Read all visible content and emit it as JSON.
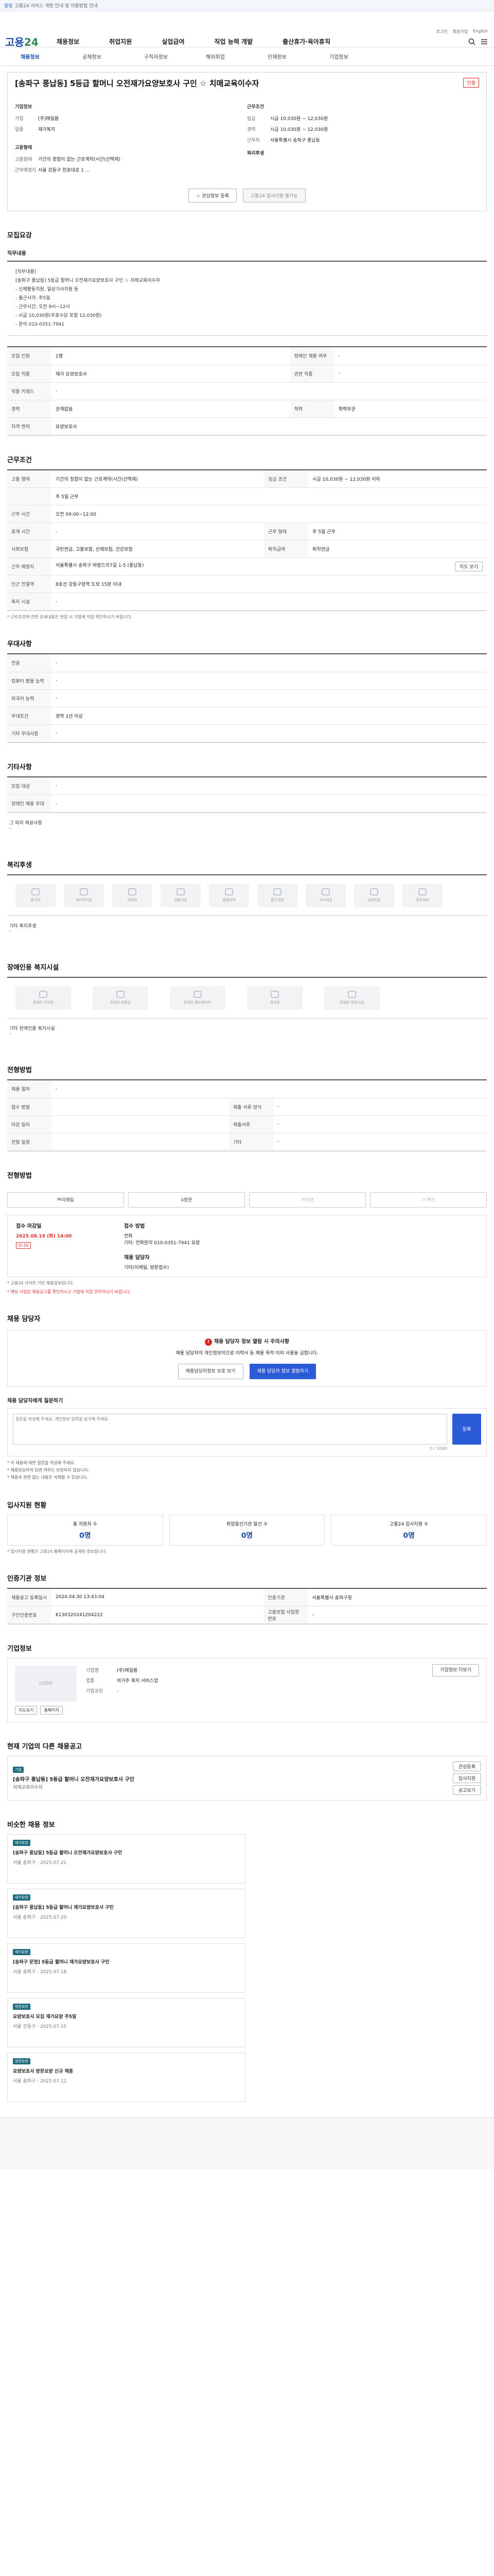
{
  "topbar": {
    "notice": "알림",
    "text": "고용24 서비스 개편 안내 및 이용방법 안내"
  },
  "header": {
    "logo_main": "고용",
    "logo_sub": "24",
    "gnb": [
      "채용정보",
      "취업지원",
      "실업급여",
      "직업 능력 개발",
      "출산휴가·육아휴직"
    ],
    "util": [
      "로그인",
      "회원가입",
      "English"
    ]
  },
  "subnav": {
    "items": [
      "채용정보",
      "공채정보",
      "구직자정보",
      "해외취업",
      "인재정보",
      "기업정보"
    ],
    "active": "채용정보"
  },
  "job": {
    "title": "[송파구 풍납동] 5등급 할머니 오전재가요양보호사 구인 ☆ 치매교육이수자",
    "badge": "인증",
    "employer_head": "기업정보",
    "employer_rows": [
      {
        "k": "기업",
        "v": "[주]매일봄"
      },
      {
        "k": "업종",
        "v": "재가복지"
      }
    ],
    "recruit_head": "고용형태",
    "recruit_rows": [
      {
        "k": "고용형태",
        "v": "기간의 정함이 없는 근로계약(시간(선택제)"
      },
      {
        "k": "근무예정지",
        "v": "서울 강동구 천호대로 1 ..."
      }
    ],
    "period_head": "근무조건",
    "period_rows": [
      {
        "k": "임금",
        "v": "시급 10,030원 ~ 12,030원"
      },
      {
        "k": "경력",
        "v": "시급 10,030원 ~ 12,030원"
      },
      {
        "k": "근무지",
        "v": "서울특별시 송파구 풍납동"
      }
    ],
    "extra_head": "복리후생",
    "btn_interest": "관심정보 등록",
    "btn_share": "고용24 입사지원 불가능"
  },
  "summary": {
    "title": "모집요강",
    "sub1": "직무내용",
    "duties_text": "[직무내용]\n[송파구 풍납동] 5등급 할머니 오전재가요양보호사 구인 ☆ 치매교육이수자\n- 신체활동지원, 일상가사지원 등\n- 출근시각: 주5일\n- 근무시간: 오전 9시~12시\n- 시급 10,030원(주휴수당 포함 12,030원)\n- 문의 010-0351-7941",
    "rows": [
      {
        "k": "모집 인원",
        "v": "1명",
        "k2": "장애인 채용 여부",
        "v2": "-"
      },
      {
        "k": "모집 직종",
        "v": "재가 요양보호사",
        "k2": "관련 직종",
        "v2": "-"
      },
      {
        "k": "직종 키워드",
        "v": "-",
        "k2": "",
        "v2": ""
      },
      {
        "k": "경력",
        "v": "관계없음",
        "k2": "학력",
        "v2": "학력무관"
      },
      {
        "k": "자격 면허",
        "v": "요양보호사",
        "k2": "",
        "v2": ""
      }
    ]
  },
  "conditions": {
    "title": "근무조건",
    "rows": [
      {
        "k": "고용 형태",
        "v": "기간의 정함이 없는 근로계약(시간(선택제)",
        "k2": "임금 조건",
        "v2": "시급 10,030원 ~ 12,030원 이하"
      },
      {
        "k": "",
        "v": "주 5일 근무",
        "k2": "",
        "v2": ""
      },
      {
        "k": "근무 시간",
        "v": "오전 09:00~12:00",
        "k2": "",
        "v2": ""
      },
      {
        "k": "휴게 시간",
        "v": "-",
        "k2": "근무 형태",
        "v2": "주 5일 근무"
      },
      {
        "k": "사회보험",
        "v": "국민연금, 고용보험, 산재보험, 건강보험",
        "k2": "퇴직급여",
        "v2": "퇴직연금"
      },
      {
        "k": "근무 예정지",
        "v": "서울특별시 송파구 바람드리7길 1-5 (풍납동)",
        "k2": "",
        "v2": ""
      },
      {
        "k": "인근 전철역",
        "v": "8호선 강동구청역 도보 15분 이내",
        "k2": "",
        "v2": ""
      },
      {
        "k": "복지 시설",
        "v": "-",
        "k2": "",
        "v2": ""
      }
    ],
    "map_btn": "지도 보기",
    "note": "* 근로조건에 관한 상세내용은 면접 시 기업에 직접 확인하시기 바랍니다."
  },
  "prefer": {
    "title": "우대사항",
    "rows": [
      {
        "k": "전공",
        "v": "-"
      },
      {
        "k": "컴퓨터 활용 능력",
        "v": "-"
      },
      {
        "k": "외국어 능력",
        "v": "-"
      },
      {
        "k": "우대조건",
        "v": "경력 1년 이상"
      },
      {
        "k": "기타 우대사항",
        "v": "-"
      }
    ]
  },
  "etc": {
    "title": "기타사항",
    "rows": [
      {
        "k": "모집 대상",
        "v": "-"
      },
      {
        "k": "장애인 채용 우대",
        "v": "-"
      }
    ],
    "sub": "그 외의 제공사항",
    "sub_value": "-"
  },
  "welfare": {
    "title": "복리후생",
    "items": [
      "휴가비",
      "자녀학자금",
      "의료비",
      "선물지원",
      "명절상여",
      "통근차량",
      "식사제공",
      "교육지원",
      "경조사비"
    ],
    "other_label": "기타 복리후생",
    "other_value": "-"
  },
  "disabled": {
    "title": "장애인용 복지시설",
    "items": [
      "장애인 주차장",
      "장애인 화장실",
      "장애인 엘리베이터",
      "경사로",
      "장애인 편의시설"
    ],
    "other_label": "기타 장애인용 복지시설",
    "other_value": "-"
  },
  "process": {
    "title": "전형방법",
    "rows": [
      {
        "k": "채용 절차",
        "v": "-"
      },
      {
        "k": "접수 방법",
        "v": "",
        "k2": "제출 서류 양식",
        "v2": "-"
      },
      {
        "k": "마감 일자",
        "v": "",
        "k2": "제출서류",
        "v2": "-"
      },
      {
        "k": "전형 일정",
        "v": "",
        "k2": "기타",
        "v2": "-"
      }
    ]
  },
  "apply": {
    "title": "전형방법",
    "methods": [
      "이메일",
      "방문",
      "우편",
      "팩스"
    ],
    "method_enabled": [
      true,
      true,
      false,
      false
    ],
    "period_label": "접수 마감일",
    "period_value": "2025.08.19 (화) 14:00",
    "dday": "D-30",
    "contact_label": "접수 방법",
    "contact_lines": [
      "전화",
      "기타: 전화문의 010-0351-7941 요망"
    ],
    "manager_label": "채용 담당자",
    "manager_value": "기타(이메일, 방문접수)",
    "notes": [
      "* 고용24 사이트 기반 채용정보입니다.",
      "* 해당 사업장 채용공고를 확인하시고 기업에 직접 연락하시기 바랍니다."
    ]
  },
  "officer": {
    "title": "채용 담당자",
    "warn_title": "채용 담당자 정보 열람 시 주의사항",
    "warn_text": "채용 담당자의 개인정보이므로 이력서 등 채용 목적 이외 사용을 금합니다.",
    "btn1": "채용담당자정보 보호 보기",
    "btn2": "채용 담당자 정보 열람하기"
  },
  "qna": {
    "title": "채용 담당자에게 질문하기",
    "count": "0 / 1000",
    "placeholder": "질문을 작성해 주세요. 개인정보 입력을 삼가해 주세요.",
    "submit": "등록",
    "notes": [
      "* 이 채용에 대한 질문을 작성해 주세요.",
      "* 채용담당자의 답변 여부는 보장되지 않습니다.",
      "* 채용과 관련 없는 내용은 삭제될 수 있습니다."
    ]
  },
  "status": {
    "title": "입사지원 현황",
    "items": [
      {
        "label": "총 지원자 수",
        "value": "0명"
      },
      {
        "label": "취업알선기관 알선 수",
        "value": "0명"
      },
      {
        "label": "고용24 입사지원 수",
        "value": "0명"
      }
    ],
    "note": "* 입사지원 현황은 고용24 홈페이지에 공개된 정보입니다."
  },
  "meta": {
    "title": "인증기관 정보",
    "rows": [
      {
        "k": "채용공고 등록일시",
        "v": "2024.04.30 13:43:04",
        "k2": "인증기관",
        "v2": "서울특별시 송파구청"
      },
      {
        "k": "구인인증번호",
        "v": "K130320241204222",
        "k2": "고용보험 사업장 번호",
        "v2": "-"
      }
    ]
  },
  "company": {
    "title": "기업정보",
    "logo_text": "LOGO",
    "name_label": "기업명",
    "name_value": "(주)매일봄",
    "industry_label": "업종",
    "industry_value": "비거주 복지 서비스업",
    "size_label": "기업규모",
    "size_value": "-",
    "btn_map": "지도보기",
    "btn_home": "홈페이지",
    "btn_more": "기업정보 더보기"
  },
  "other_jobs": {
    "title": "현재 기업의 다른 채용공고",
    "main_card": {
      "tag": "기업",
      "title": "[송파구 풍납동] 5등급 할머니 오전재가요양보호사 구인",
      "subtitle": "치매교육이수자"
    },
    "card_btns": [
      "관심등록",
      "입사지원",
      "공고보기"
    ]
  },
  "similar": {
    "title": "비슷한 채용 정보",
    "cards": [
      {
        "tag": "재가요양",
        "title": "[송파구 풍납동] 5등급 할머니 오전재가요양보호사 구인",
        "meta": "서울 송파구 · 2025.07.21"
      },
      {
        "tag": "재가요양",
        "title": "[송파구 풍납동] 5등급 할머니 재가요양보호사 구인",
        "meta": "서울 송파구 · 2025.07.20"
      },
      {
        "tag": "재가요양",
        "title": "[송파구 문정] 5등급 할머니 재가요양보호사 구인",
        "meta": "서울 송파구 · 2025.07.18"
      },
      {
        "tag": "방문요양",
        "title": "요양보호사 모집 재가요양 주5일",
        "meta": "서울 강동구 · 2025.07.15"
      },
      {
        "tag": "방문요양",
        "title": "요양보호사 방문요양 신규 채용",
        "meta": "서울 송파구 · 2025.07.12"
      }
    ]
  }
}
